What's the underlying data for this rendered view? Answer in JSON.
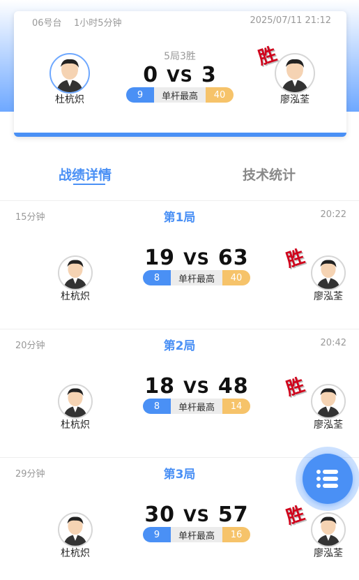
{
  "summary": {
    "table_no": "06号台",
    "duration": "1小时5分钟",
    "datetime": "2025/07/11 21:12",
    "format": "5局3胜",
    "left_player": "杜杭炽",
    "right_player": "廖泓荃",
    "left_score": "0",
    "vs": "VS",
    "right_score": "3",
    "win_label": "胜",
    "highbreak_left": "9",
    "highbreak_label": "单杆最高",
    "highbreak_right": "40"
  },
  "tabs": {
    "detail": "战绩详情",
    "stats": "技术统计"
  },
  "games": [
    {
      "duration": "15分钟",
      "title": "第1局",
      "time": "20:22",
      "left_player": "杜杭炽",
      "right_player": "廖泓荃",
      "left_score": "19",
      "vs": "VS",
      "right_score": "63",
      "win_label": "胜",
      "highbreak_left": "8",
      "highbreak_label": "单杆最高",
      "highbreak_right": "40"
    },
    {
      "duration": "20分钟",
      "title": "第2局",
      "time": "20:42",
      "left_player": "杜杭炽",
      "right_player": "廖泓荃",
      "left_score": "18",
      "vs": "VS",
      "right_score": "48",
      "win_label": "胜",
      "highbreak_left": "8",
      "highbreak_label": "单杆最高",
      "highbreak_right": "14"
    },
    {
      "duration": "29分钟",
      "title": "第3局",
      "time": "",
      "left_player": "杜杭炽",
      "right_player": "廖泓荃",
      "left_score": "30",
      "vs": "VS",
      "right_score": "57",
      "win_label": "胜",
      "highbreak_left": "9",
      "highbreak_label": "单杆最高",
      "highbreak_right": "16"
    }
  ],
  "fab": {
    "icon": "list-icon"
  },
  "colors": {
    "accent": "#4a90f5",
    "highbreak_right": "#f6c36a",
    "win": "#d0021b"
  }
}
